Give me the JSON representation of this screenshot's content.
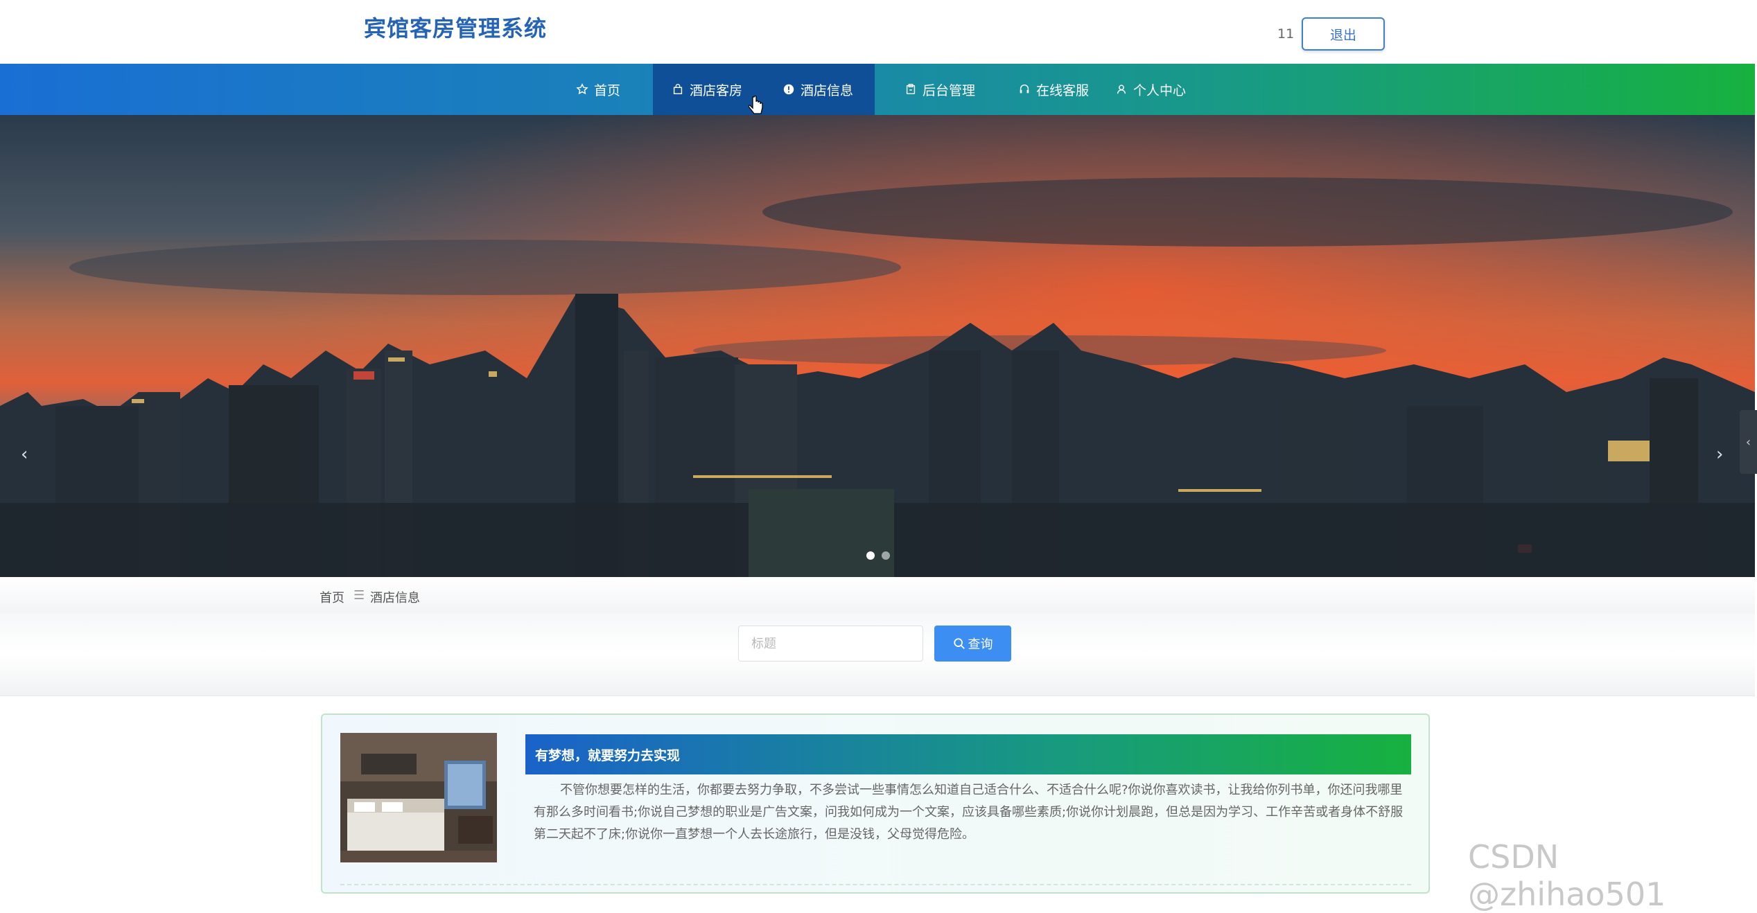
{
  "header": {
    "site_title": "宾馆客房管理系统",
    "user_name": "11",
    "logout_label": "退出"
  },
  "nav": {
    "items": [
      {
        "label": "首页",
        "icon": "star-icon"
      },
      {
        "label": "酒店客房",
        "icon": "bag-icon",
        "active": true
      },
      {
        "label": "酒店信息",
        "icon": "info-icon"
      },
      {
        "label": "后台管理",
        "icon": "clipboard-icon"
      },
      {
        "label": "在线客服",
        "icon": "headset-icon"
      },
      {
        "label": "个人中心",
        "icon": "user-icon"
      }
    ]
  },
  "banner": {
    "prev_icon": "chevron-left-icon",
    "next_icon": "chevron-right-icon",
    "slide_count": 2,
    "active_slide": 1
  },
  "breadcrumb": {
    "home": "首页",
    "separator": "☰",
    "current": "酒店信息"
  },
  "search": {
    "placeholder": "标题",
    "button_label": "查询"
  },
  "card": {
    "title": "有梦想，就要努力去实现",
    "body": "不管你想要怎样的生活，你都要去努力争取，不多尝试一些事情怎么知道自己适合什么、不适合什么呢?你说你喜欢读书，让我给你列书单，你还问我哪里有那么多时间看书;你说自己梦想的职业是广告文案，问我如何成为一个文案，应该具备哪些素质;你说你计划晨跑，但总是因为学习、工作辛苦或者身体不舒服第二天起不了床;你说你一直梦想一个人去长途旅行，但是没钱，父母觉得危险。"
  },
  "watermark": "CSDN @zhihao501",
  "colors": {
    "nav_start": "#1a6fd4",
    "nav_end": "#17b13f",
    "active_nav": "#0e4f97",
    "accent_button": "#3d8ef3",
    "title_blue": "#2563b5"
  }
}
